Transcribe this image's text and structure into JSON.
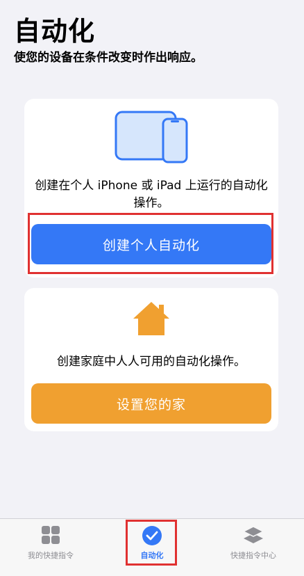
{
  "header": {
    "title": "自动化",
    "subtitle": "使您的设备在条件改变时作出响应。"
  },
  "personal_card": {
    "icon": "iphone-ipad-icon",
    "description": "创建在个人 iPhone 或 iPad 上运行的自动化操作。",
    "button_label": "创建个人自动化",
    "button_color": "#3478f6"
  },
  "home_card": {
    "icon": "house-icon",
    "description": "创建家庭中人人可用的自动化操作。",
    "button_label": "设置您的家",
    "button_color": "#f0a030"
  },
  "tabbar": {
    "tabs": [
      {
        "label": "我的快捷指令",
        "icon": "grid-icon",
        "active": false
      },
      {
        "label": "自动化",
        "icon": "checkmark-circle-icon",
        "active": true
      },
      {
        "label": "快捷指令中心",
        "icon": "layers-icon",
        "active": false
      }
    ]
  },
  "highlight_color": "#e03131"
}
